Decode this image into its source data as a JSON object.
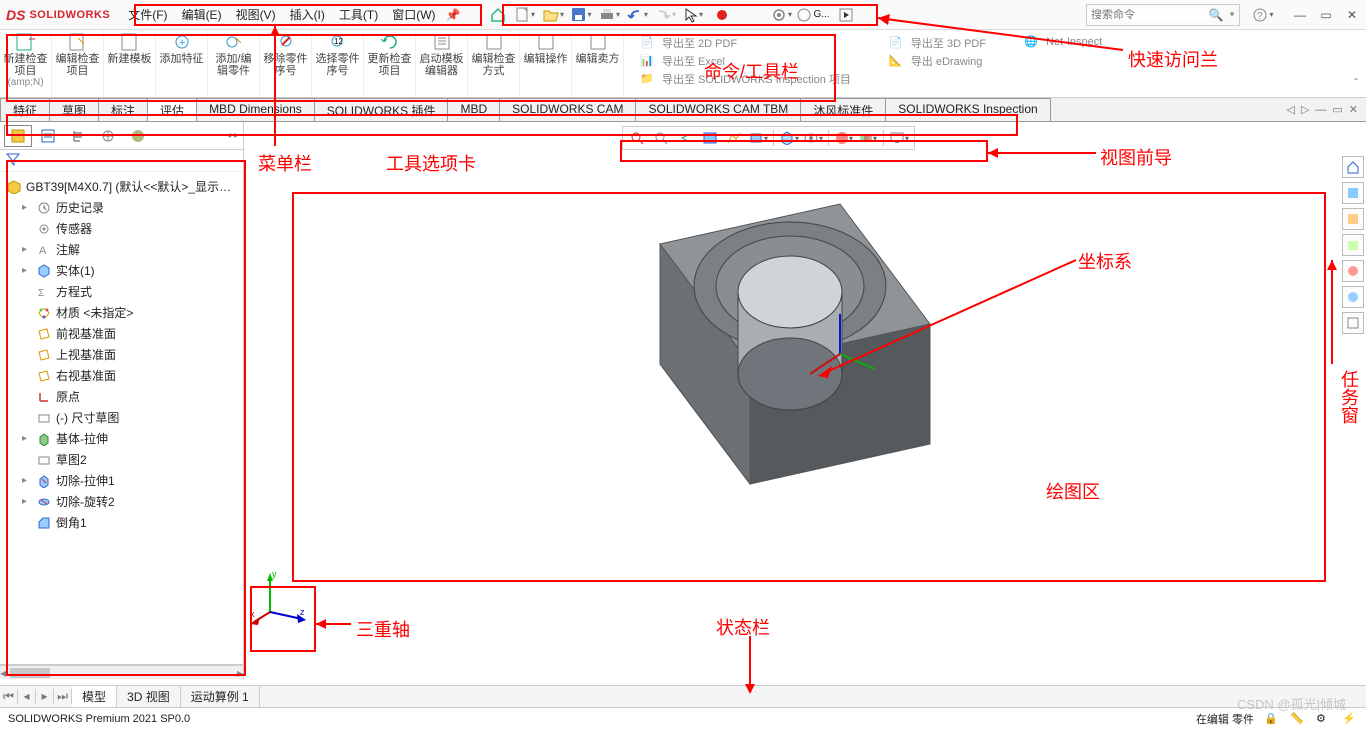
{
  "app": {
    "brand_ds": "DS",
    "brand_sw": "SOLIDWORKS"
  },
  "menu": {
    "items": [
      "文件(F)",
      "编辑(E)",
      "视图(V)",
      "插入(I)",
      "工具(T)",
      "窗口(W)"
    ],
    "pin": "📌"
  },
  "qat": {
    "search_placeholder": "搜索命令"
  },
  "ribbon": {
    "items": [
      {
        "label": "新建检查项目",
        "sub": "(amp;N)"
      },
      {
        "label": "编辑检查项目"
      },
      {
        "label": "新建模板"
      },
      {
        "label": "添加特征"
      },
      {
        "label": "添加/编辑零件"
      },
      {
        "label": "移除零件序号"
      },
      {
        "label": "选择零件序号"
      },
      {
        "label": "更新检查项目"
      },
      {
        "label": "启动模板编辑器"
      },
      {
        "label": "编辑检查方式"
      },
      {
        "label": "编辑操作"
      },
      {
        "label": "编辑卖方"
      }
    ],
    "exports": [
      {
        "label": "导出至 2D PDF"
      },
      {
        "label": "导出至 Excel"
      },
      {
        "label": "导出至 SOLIDWORKS Inspection 项目"
      },
      {
        "label": "导出至 3D PDF"
      },
      {
        "label": "导出 eDrawing"
      },
      {
        "label": "Net-Inspect"
      }
    ]
  },
  "tabs": {
    "items": [
      "特征",
      "草图",
      "标注",
      "评估",
      "MBD Dimensions",
      "SOLIDWORKS 插件",
      "MBD",
      "SOLIDWORKS CAM",
      "SOLIDWORKS CAM TBM",
      "沐风标准件",
      "SOLIDWORKS Inspection"
    ],
    "active": 3
  },
  "tree": {
    "root": "GBT39[M4X0.7]  (默认<<默认>_显示…",
    "items": [
      {
        "label": "历史记录",
        "icon": "history-icon",
        "exp": "▸"
      },
      {
        "label": "传感器",
        "icon": "sensor-icon"
      },
      {
        "label": "注解",
        "icon": "annotation-icon",
        "exp": "▸"
      },
      {
        "label": "实体(1)",
        "icon": "solid-body-icon",
        "exp": "▸"
      },
      {
        "label": "方程式",
        "icon": "equation-icon"
      },
      {
        "label": "材质 <未指定>",
        "icon": "material-icon"
      },
      {
        "label": "前视基准面",
        "icon": "plane-icon"
      },
      {
        "label": "上视基准面",
        "icon": "plane-icon"
      },
      {
        "label": "右视基准面",
        "icon": "plane-icon"
      },
      {
        "label": "原点",
        "icon": "origin-icon"
      },
      {
        "label": "(-) 尺寸草图",
        "icon": "sketch-icon"
      },
      {
        "label": "基体-拉伸",
        "icon": "extrude-icon",
        "exp": "▸"
      },
      {
        "label": "草图2",
        "icon": "sketch-icon"
      },
      {
        "label": "切除-拉伸1",
        "icon": "cut-extrude-icon",
        "exp": "▸"
      },
      {
        "label": "切除-旋转2",
        "icon": "cut-revolve-icon",
        "exp": "▸"
      },
      {
        "label": "倒角1",
        "icon": "chamfer-icon"
      }
    ]
  },
  "bottom_tabs": {
    "items": [
      "模型",
      "3D 视图",
      "运动算例 1"
    ],
    "active": 0
  },
  "status": {
    "left": "SOLIDWORKS Premium 2021 SP0.0",
    "right": "在编辑 零件"
  },
  "annotations": {
    "menu": "菜单栏",
    "toolbar": "命令/工具栏",
    "qat": "快速访问兰",
    "ribbon_tabs": "工具选项卡",
    "view_nav": "视图前导",
    "coord": "坐标系",
    "graphics": "绘图区",
    "triad": "三重轴",
    "status": "状态栏",
    "taskpane": "任务窗"
  },
  "watermark": "CSDN @孤光|倾城"
}
